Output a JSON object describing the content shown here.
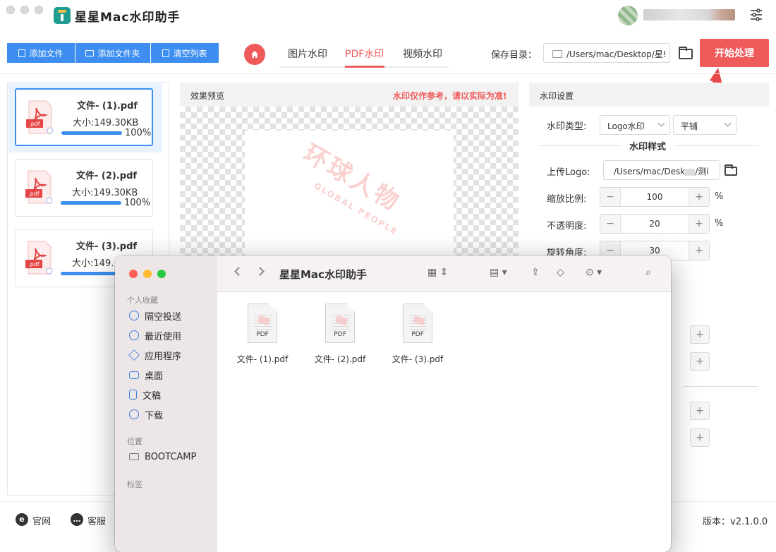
{
  "app": {
    "title": "星星Mac水印助手"
  },
  "toolbar": {
    "add_file": "添加文件",
    "add_folder": "添加文件夹",
    "clear_list": "清空列表",
    "start": "开始处理"
  },
  "tabs": [
    {
      "label": "图片水印",
      "active": false
    },
    {
      "label": "PDF水印",
      "active": true
    },
    {
      "label": "视频水印",
      "active": false
    }
  ],
  "save": {
    "label": "保存目录：",
    "path": "/Users/mac/Desktop/星!"
  },
  "files": [
    {
      "name": "文件- (1).pdf",
      "size": "大小:149.30KB",
      "percent": "100%",
      "progress": 1.0
    },
    {
      "name": "文件- (2).pdf",
      "size": "大小:149.30KB",
      "percent": "100%",
      "progress": 1.0
    },
    {
      "name": "文件- (3).pdf",
      "size": "大小:149.",
      "percent": "",
      "progress": 1.0
    }
  ],
  "preview": {
    "title": "效果预览",
    "note": "水印仅作参考，请以实际为准!",
    "wm_cn": "环球人物",
    "wm_en": "GLOBAL PEOPLE"
  },
  "settings": {
    "title": "水印设置",
    "type_label": "水印类型:",
    "type_value": "Logo水印",
    "tile_value": "平铺",
    "style_title": "水印样式",
    "logo_label": "上传Logo:",
    "logo_path": "/Users/mac/Desk",
    "logo_path_end": "/测i",
    "scale_label": "缩放比例:",
    "scale_value": "100",
    "opacity_label": "不透明度:",
    "opacity_value": "20",
    "rotate_label": "旋转角度:",
    "rotate_value": "30",
    "percent_unit": "%"
  },
  "footer": {
    "website": "官网",
    "service": "客服",
    "version": "版本：v2.1.0.0"
  },
  "finder": {
    "title": "星星Mac水印助手",
    "favorites_title": "个人收藏",
    "favorites": [
      "隔空投送",
      "最近使用",
      "应用程序",
      "桌面",
      "文稿",
      "下载"
    ],
    "locations_title": "位置",
    "locations": [
      "BOOTCAMP"
    ],
    "tags_title": "标签",
    "files": [
      "文件- (1).pdf",
      "文件- (2).pdf",
      "文件- (3).pdf"
    ],
    "pdf_badge": "PDF",
    "icon_labels": [
      "airdrop-icon",
      "clock-icon",
      "apps-icon",
      "desktop-icon",
      "document-icon",
      "download-icon"
    ]
  },
  "colors": {
    "accent": "#ef5a5a",
    "primary": "#3d8ef0"
  }
}
